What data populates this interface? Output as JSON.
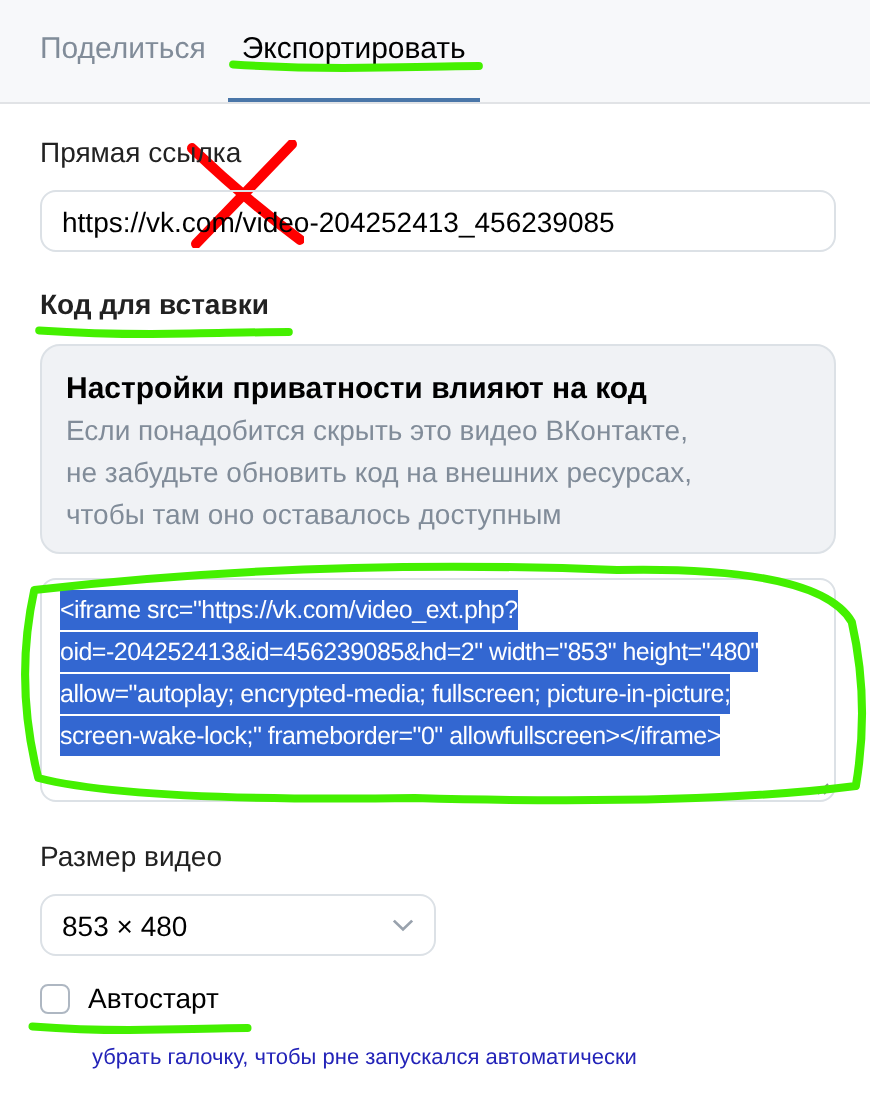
{
  "tabs": [
    {
      "label": "Поделиться",
      "selected": false,
      "underlined": false
    },
    {
      "label": "Экспортировать",
      "selected": true,
      "underlined": true
    }
  ],
  "direct_link": {
    "label": "Прямая ссылка",
    "value": "https://vk.com/video-204252413_456239085",
    "crossed_out": true
  },
  "embed_code": {
    "label": "Код для вставки",
    "underlined": true,
    "notice": {
      "title": "Настройки приватности влияют на код",
      "text": "Если понадобится скрыть это видео ВКонтакте,\nне забудьте обновить код на внешних ресурсах,\nчтобы там оно оставалось доступным"
    },
    "value": "<iframe src=\"https://vk.com/video_ext.php?oid=-204252413&id=456239085&hd=2\" width=\"853\" height=\"480\" allow=\"autoplay; encrypted-media; fullscreen; picture-in-picture; screen-wake-lock;\" frameborder=\"0\" allowfullscreen></iframe>",
    "selected": true,
    "circled": true
  },
  "video_size": {
    "label": "Размер видео",
    "value": "853 × 480"
  },
  "autostart": {
    "label": "Автостарт",
    "checked": false,
    "underlined": true
  },
  "note": "убрать галочку, чтобы рне запускался автоматически"
}
